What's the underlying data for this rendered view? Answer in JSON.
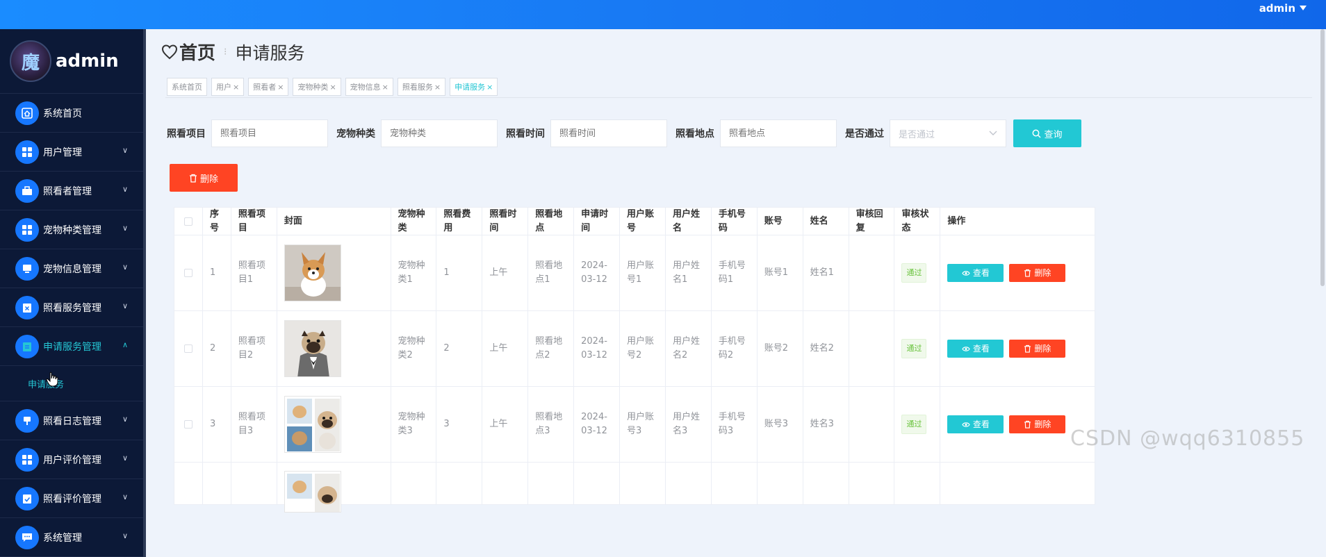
{
  "header": {
    "user": "admin"
  },
  "sidebar": {
    "profile_name": "admin",
    "avatar_char": "魔",
    "items": [
      {
        "label": "系统首页",
        "icon": "home-icon"
      },
      {
        "label": "用户管理",
        "icon": "grid-icon"
      },
      {
        "label": "照看者管理",
        "icon": "briefcase-icon"
      },
      {
        "label": "宠物种类管理",
        "icon": "grid-icon"
      },
      {
        "label": "宠物信息管理",
        "icon": "monitor-icon"
      },
      {
        "label": "照看服务管理",
        "icon": "clipboard-x-icon"
      },
      {
        "label": "申请服务管理",
        "icon": "clipboard-icon"
      },
      {
        "label": "照看日志管理",
        "icon": "pin-icon"
      },
      {
        "label": "用户评价管理",
        "icon": "grid-icon"
      },
      {
        "label": "照看评价管理",
        "icon": "clipboard-check-icon"
      },
      {
        "label": "系统管理",
        "icon": "chat-icon"
      }
    ],
    "subitem": "申请服务"
  },
  "breadcrumb": {
    "home": "首页",
    "current": "申请服务"
  },
  "tabs": [
    {
      "label": "系统首页",
      "closable": false
    },
    {
      "label": "用户",
      "closable": true
    },
    {
      "label": "照看者",
      "closable": true
    },
    {
      "label": "宠物种类",
      "closable": true
    },
    {
      "label": "宠物信息",
      "closable": true
    },
    {
      "label": "照看服务",
      "closable": true
    },
    {
      "label": "申请服务",
      "closable": true
    }
  ],
  "search": {
    "fields": [
      {
        "label": "照看项目",
        "placeholder": "照看项目"
      },
      {
        "label": "宠物种类",
        "placeholder": "宠物种类"
      },
      {
        "label": "照看时间",
        "placeholder": "照看时间"
      },
      {
        "label": "照看地点",
        "placeholder": "照看地点"
      }
    ],
    "select_label": "是否通过",
    "select_placeholder": "是否通过",
    "query_button": "查询"
  },
  "delete_button": "删除",
  "table": {
    "columns": [
      "序号",
      "照看项目",
      "封面",
      "宠物种类",
      "照看费用",
      "照看时间",
      "照看地点",
      "申请时间",
      "用户账号",
      "用户姓名",
      "手机号码",
      "账号",
      "姓名",
      "审核回复",
      "审核状态",
      "操作"
    ],
    "rows": [
      {
        "idx": "1",
        "project": "照看项目1",
        "type": "宠物种类1",
        "fee": "1",
        "time": "上午",
        "place": "照看地点1",
        "apply_time": "2024-03-12",
        "account": "用户账号1",
        "uname": "用户姓名1",
        "phone": "手机号码1",
        "acc": "账号1",
        "name": "姓名1",
        "reply": "",
        "status": "通过",
        "view": "查看",
        "del": "删除"
      },
      {
        "idx": "2",
        "project": "照看项目2",
        "type": "宠物种类2",
        "fee": "2",
        "time": "上午",
        "place": "照看地点2",
        "apply_time": "2024-03-12",
        "account": "用户账号2",
        "uname": "用户姓名2",
        "phone": "手机号码2",
        "acc": "账号2",
        "name": "姓名2",
        "reply": "",
        "status": "通过",
        "view": "查看",
        "del": "删除"
      },
      {
        "idx": "3",
        "project": "照看项目3",
        "type": "宠物种类3",
        "fee": "3",
        "time": "上午",
        "place": "照看地点3",
        "apply_time": "2024-03-12",
        "account": "用户账号3",
        "uname": "用户姓名3",
        "phone": "手机号码3",
        "acc": "账号3",
        "name": "姓名3",
        "reply": "",
        "status": "通过",
        "view": "查看",
        "del": "删除"
      }
    ]
  },
  "watermark": "CSDN @wqq6310855"
}
